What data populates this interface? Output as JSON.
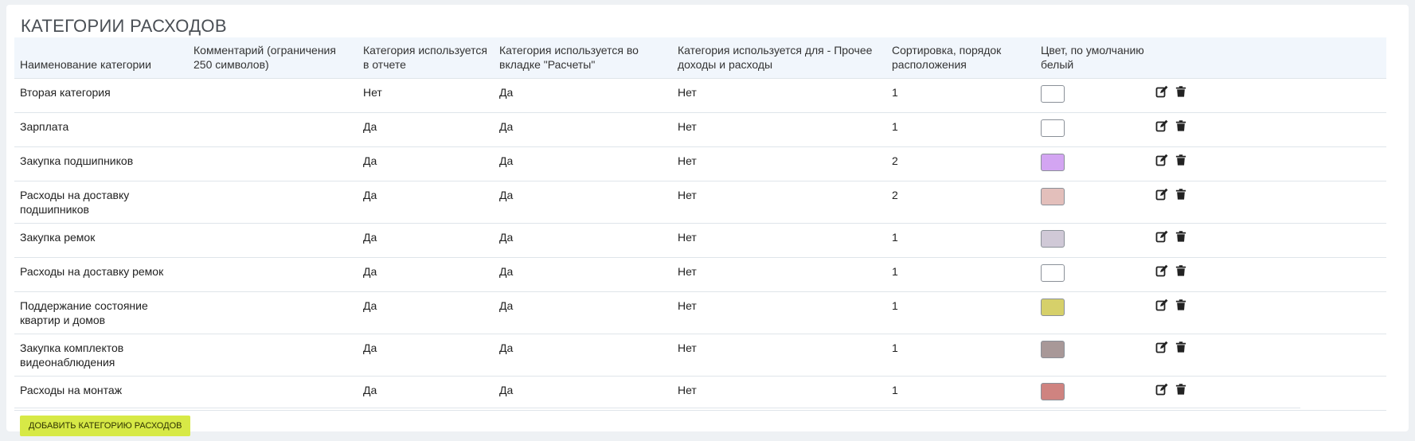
{
  "page": {
    "title": "КАТЕГОРИИ РАСХОДОВ"
  },
  "table": {
    "headers": [
      "Наименование категории",
      "Комментарий (ограничения 250 символов)",
      "Категория используется в отчете",
      "Категория используется во вкладке \"Расчеты\"",
      "Категория используется для - Прочее доходы и расходы",
      "Сортировка, порядок расположения",
      "Цвет, по умолчанию белый"
    ],
    "rows": [
      {
        "name": "Вторая категория",
        "comment": "",
        "in_report": "Нет",
        "in_calc": "Да",
        "in_other": "Нет",
        "sort": "1",
        "color": "#ffffff"
      },
      {
        "name": "Зарплата",
        "comment": "",
        "in_report": "Да",
        "in_calc": "Да",
        "in_other": "Нет",
        "sort": "1",
        "color": "#ffffff"
      },
      {
        "name": "Закупка подшипников",
        "comment": "",
        "in_report": "Да",
        "in_calc": "Да",
        "in_other": "Нет",
        "sort": "2",
        "color": "#d3a5f2"
      },
      {
        "name": "Расходы на доставку подшипников",
        "comment": "",
        "in_report": "Да",
        "in_calc": "Да",
        "in_other": "Нет",
        "sort": "2",
        "color": "#e3bfbb"
      },
      {
        "name": "Закупка ремок",
        "comment": "",
        "in_report": "Да",
        "in_calc": "Да",
        "in_other": "Нет",
        "sort": "1",
        "color": "#d0c9d7"
      },
      {
        "name": "Расходы на доставку ремок",
        "comment": "",
        "in_report": "Да",
        "in_calc": "Да",
        "in_other": "Нет",
        "sort": "1",
        "color": "#ffffff"
      },
      {
        "name": "Поддержание состояние квартир и домов",
        "comment": "",
        "in_report": "Да",
        "in_calc": "Да",
        "in_other": "Нет",
        "sort": "1",
        "color": "#d6d06a"
      },
      {
        "name": "Закупка комплектов видеонаблюдения",
        "comment": "",
        "in_report": "Да",
        "in_calc": "Да",
        "in_other": "Нет",
        "sort": "1",
        "color": "#a89898"
      },
      {
        "name": "Расходы на монтаж",
        "comment": "",
        "in_report": "Да",
        "in_calc": "Да",
        "in_other": "Нет",
        "sort": "1",
        "color": "#cf8380"
      }
    ],
    "row_actions": {
      "edit_icon": "edit-icon",
      "delete_icon": "trash-icon"
    }
  },
  "footer": {
    "add_button_label": "ДОБАВИТЬ КАТЕГОРИЮ РАСХОДОВ"
  }
}
